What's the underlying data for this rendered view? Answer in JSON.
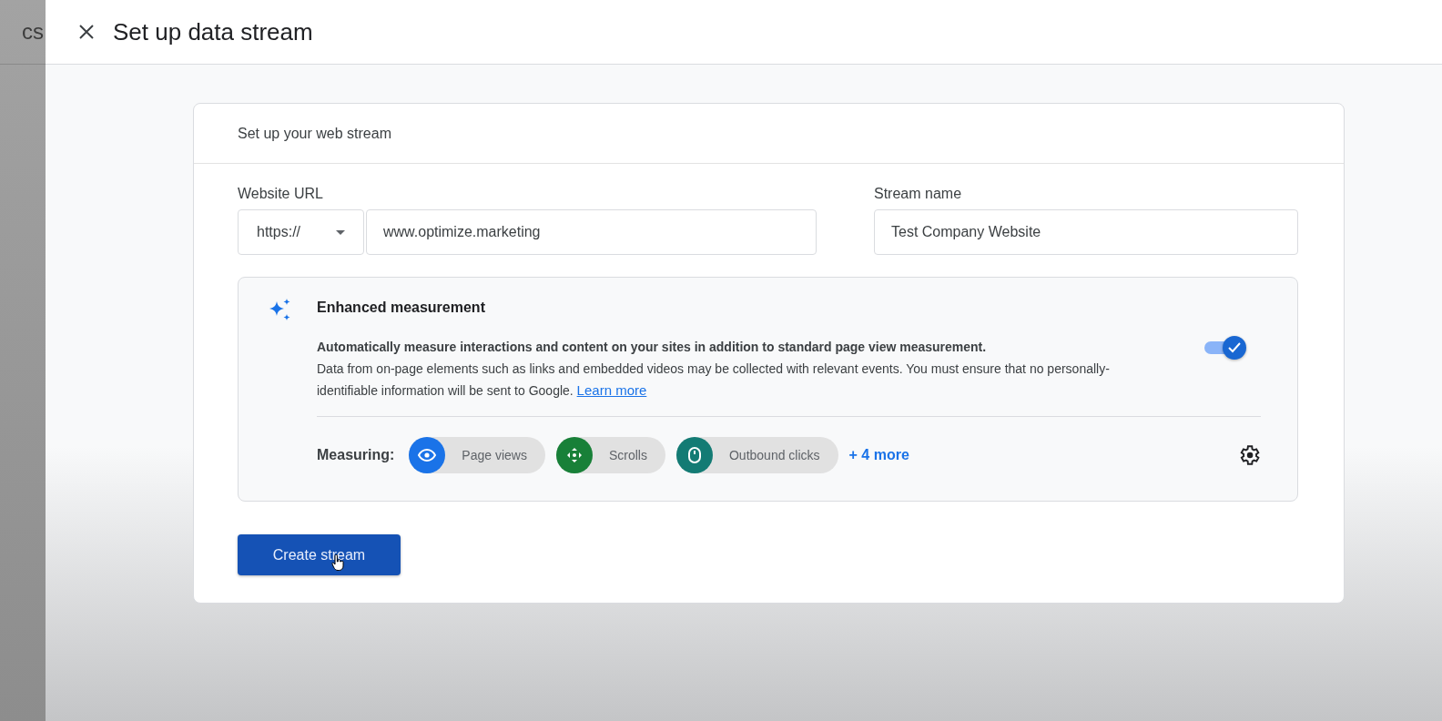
{
  "background": {
    "text": "cs"
  },
  "header": {
    "title": "Set up data stream"
  },
  "card": {
    "title": "Set up your web stream",
    "website_url": {
      "label": "Website URL",
      "protocol": "https://",
      "value": "www.optimize.marketing"
    },
    "stream_name": {
      "label": "Stream name",
      "value": "Test Company Website"
    },
    "enhanced": {
      "title": "Enhanced measurement",
      "on": true,
      "lead": "Automatically measure interactions and content on your sites in addition to standard page view measurement.",
      "body": "Data from on-page elements such as links and embedded videos may be collected with relevant events. You must ensure that no personally-identifiable information will be sent to Google.",
      "link": "Learn more",
      "measuring_label": "Measuring:",
      "chips": [
        {
          "label": "Page views",
          "kind": "eye",
          "color": "#1a73e8"
        },
        {
          "label": "Scrolls",
          "kind": "move",
          "color": "#188038"
        },
        {
          "label": "Outbound clicks",
          "kind": "mouse",
          "color": "#137b74"
        }
      ],
      "more": "+ 4 more"
    },
    "button": "Create stream"
  }
}
